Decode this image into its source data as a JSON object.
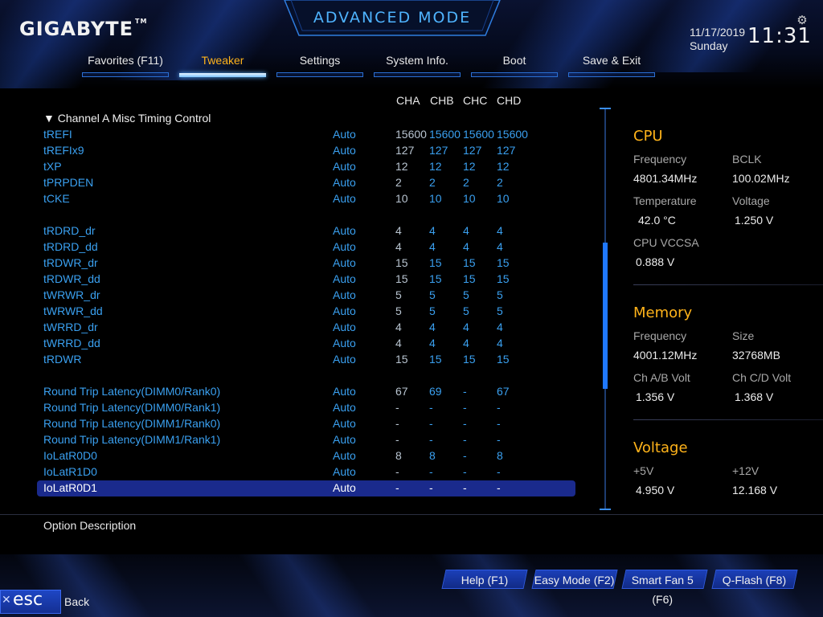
{
  "header": {
    "brand": "GIGABYTE",
    "brand_mark": "TM",
    "mode_title": "ADVANCED MODE",
    "date": "11/17/2019",
    "day": "Sunday",
    "time": "11:31",
    "icons": [
      "gear-icon"
    ]
  },
  "tabs": [
    {
      "label": "Favorites (F11)",
      "active": false
    },
    {
      "label": "Tweaker",
      "active": true
    },
    {
      "label": "Settings",
      "active": false
    },
    {
      "label": "System Info.",
      "active": false
    },
    {
      "label": "Boot",
      "active": false
    },
    {
      "label": "Save & Exit",
      "active": false
    }
  ],
  "columns": [
    "CHA",
    "CHB",
    "CHC",
    "CHD"
  ],
  "section": {
    "arrow": "▼",
    "title": "Channel A Misc Timing Control"
  },
  "rows": [
    {
      "name": "tREFI",
      "value": "Auto",
      "cha": "15600",
      "chb": "15600",
      "chc": "15600",
      "chd": "15600"
    },
    {
      "name": "tREFIx9",
      "value": "Auto",
      "cha": "127",
      "chb": "127",
      "chc": "127",
      "chd": "127"
    },
    {
      "name": "tXP",
      "value": "Auto",
      "cha": "12",
      "chb": "12",
      "chc": "12",
      "chd": "12"
    },
    {
      "name": "tPRPDEN",
      "value": "Auto",
      "cha": "2",
      "chb": "2",
      "chc": "2",
      "chd": "2"
    },
    {
      "name": "tCKE",
      "value": "Auto",
      "cha": "10",
      "chb": "10",
      "chc": "10",
      "chd": "10"
    },
    {
      "name": "tRDRD_dr",
      "value": "Auto",
      "cha": "4",
      "chb": "4",
      "chc": "4",
      "chd": "4"
    },
    {
      "name": "tRDRD_dd",
      "value": "Auto",
      "cha": "4",
      "chb": "4",
      "chc": "4",
      "chd": "4"
    },
    {
      "name": "tRDWR_dr",
      "value": "Auto",
      "cha": "15",
      "chb": "15",
      "chc": "15",
      "chd": "15"
    },
    {
      "name": "tRDWR_dd",
      "value": "Auto",
      "cha": "15",
      "chb": "15",
      "chc": "15",
      "chd": "15"
    },
    {
      "name": "tWRWR_dr",
      "value": "Auto",
      "cha": "5",
      "chb": "5",
      "chc": "5",
      "chd": "5"
    },
    {
      "name": "tWRWR_dd",
      "value": "Auto",
      "cha": "5",
      "chb": "5",
      "chc": "5",
      "chd": "5"
    },
    {
      "name": "tWRRD_dr",
      "value": "Auto",
      "cha": "4",
      "chb": "4",
      "chc": "4",
      "chd": "4"
    },
    {
      "name": "tWRRD_dd",
      "value": "Auto",
      "cha": "4",
      "chb": "4",
      "chc": "4",
      "chd": "4"
    },
    {
      "name": "tRDWR",
      "value": "Auto",
      "cha": "15",
      "chb": "15",
      "chc": "15",
      "chd": "15"
    },
    {
      "name": "Round Trip Latency(DIMM0/Rank0)",
      "value": "Auto",
      "cha": "67",
      "chb": "69",
      "chc": "-",
      "chd": "67"
    },
    {
      "name": "Round Trip Latency(DIMM0/Rank1)",
      "value": "Auto",
      "cha": "-",
      "chb": "-",
      "chc": "-",
      "chd": "-"
    },
    {
      "name": "Round Trip Latency(DIMM1/Rank0)",
      "value": "Auto",
      "cha": "-",
      "chb": "-",
      "chc": "-",
      "chd": "-"
    },
    {
      "name": "Round Trip Latency(DIMM1/Rank1)",
      "value": "Auto",
      "cha": "-",
      "chb": "-",
      "chc": "-",
      "chd": "-"
    },
    {
      "name": "IoLatR0D0",
      "value": "Auto",
      "cha": "8",
      "chb": "8",
      "chc": "-",
      "chd": "8"
    },
    {
      "name": "IoLatR1D0",
      "value": "Auto",
      "cha": "-",
      "chb": "-",
      "chc": "-",
      "chd": "-"
    },
    {
      "name": "IoLatR0D1",
      "value": "Auto",
      "cha": "-",
      "chb": "-",
      "chc": "-",
      "chd": "-",
      "selected": true
    }
  ],
  "panel": {
    "cpu": {
      "title": "CPU",
      "frequency_label": "Frequency",
      "frequency": "4801.34MHz",
      "bclk_label": "BCLK",
      "bclk": "100.02MHz",
      "temp_label": "Temperature",
      "temp": "42.0 °C",
      "voltage_label": "Voltage",
      "voltage": "1.250 V",
      "vccsa_label": "CPU VCCSA",
      "vccsa": "0.888 V"
    },
    "memory": {
      "title": "Memory",
      "frequency_label": "Frequency",
      "frequency": "4001.12MHz",
      "size_label": "Size",
      "size": "32768MB",
      "ab_label": "Ch A/B Volt",
      "ab": "1.356 V",
      "cd_label": "Ch C/D Volt",
      "cd": "1.368 V"
    },
    "voltage": {
      "title": "Voltage",
      "v5_label": "+5V",
      "v5": "4.950 V",
      "v12_label": "+12V",
      "v12": "12.168 V"
    }
  },
  "description_label": "Option Description",
  "footer": {
    "help": "Help (F1)",
    "easy": "Easy Mode (F2)",
    "fan": "Smart Fan 5 (F6)",
    "qflash": "Q-Flash (F8)",
    "esc": "esc",
    "back": "Back"
  },
  "colors": {
    "accent": "#ffb31a",
    "item_blue": "#3aa0f0",
    "selection": "#1a2a8c",
    "mode_title": "#4fb4ff"
  }
}
